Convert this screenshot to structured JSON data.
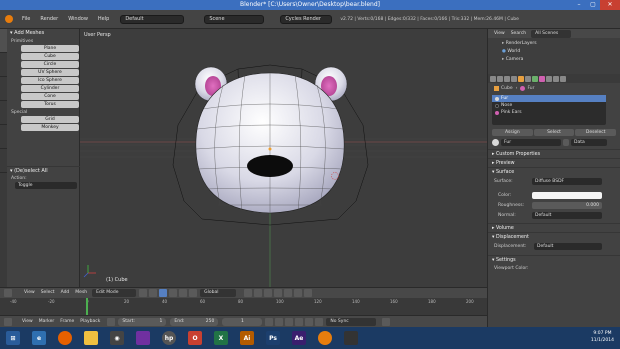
{
  "window": {
    "title": "Blender* [C:\\Users\\Owner\\Desktop\\bear.blend]",
    "minimize": "–",
    "maximize": "▢",
    "close": "✕"
  },
  "info_header": {
    "menus": [
      "File",
      "Render",
      "Window",
      "Help"
    ],
    "layout": "Default",
    "scene": "Scene",
    "engine": "Cycles Render",
    "stats": "v2.72 | Verts:0/168 | Edges:0/332 | Faces:0/166 | Tris:332 | Mem:26.46M | Cube"
  },
  "toolshelf": {
    "tabs": [
      "Tools",
      "Create",
      "Relations",
      "Animation",
      "Physics",
      "Grease Pencil"
    ],
    "add_meshes_header": "Add Meshes",
    "primitives_header": "Primitives",
    "primitives": [
      "Plane",
      "Cube",
      "Circle",
      "UV Sphere",
      "Ico Sphere",
      "Cylinder",
      "Cone",
      "Torus"
    ],
    "special_header": "Special",
    "special": [
      "Grid",
      "Monkey"
    ],
    "operator_header": "(De)select All",
    "action_label": "Action:",
    "action_value": "Toggle"
  },
  "viewport": {
    "view_label": "User Persp",
    "object_label": "(1) Cube"
  },
  "viewport_header": {
    "items": [
      "View",
      "Select",
      "Add",
      "Mesh"
    ],
    "mode": "Edit Mode",
    "pivot": "Global"
  },
  "timeline": {
    "ticks": [
      "-40",
      "-20",
      "0",
      "20",
      "40",
      "60",
      "80",
      "100",
      "120",
      "140",
      "160",
      "180",
      "200",
      "220",
      "240",
      "260"
    ],
    "current_frame": "1"
  },
  "timeline_header": {
    "items": [
      "View",
      "Marker",
      "Frame",
      "Playback"
    ],
    "start_label": "Start:",
    "start_value": "1",
    "end_label": "End:",
    "end_value": "250",
    "frame_value": "1",
    "sync": "No Sync"
  },
  "outliner": {
    "view_label": "View",
    "search_label": "Search",
    "scenes": "All Scenes",
    "rows": [
      "RenderLayers",
      "World",
      "Camera"
    ]
  },
  "properties": {
    "breadcrumb_object": "Cube",
    "breadcrumb_material": "Fur",
    "material_slots": [
      {
        "name": "Fur",
        "color": "#d8d8d8",
        "selected": true
      },
      {
        "name": "Nose",
        "color": "#111111",
        "selected": false
      },
      {
        "name": "Pink Ears",
        "color": "#d060b0",
        "selected": false
      }
    ],
    "assign_label": "Assign",
    "select_label": "Select",
    "deselect_label": "Deselect",
    "material_name": "Fur",
    "material_users": "Data",
    "sections": {
      "custom_properties": "Custom Properties",
      "preview": "Preview",
      "surface": "Surface",
      "volume": "Volume",
      "displacement": "Displacement",
      "settings": "Settings"
    },
    "surface_label": "Surface:",
    "surface_value": "Diffuse BSDF",
    "color_label": "Color:",
    "roughness_label": "Roughness:",
    "roughness_value": "0.000",
    "normal_label": "Normal:",
    "normal_value": "Default",
    "displacement_label": "Displacement:",
    "displacement_value": "Default",
    "viewport_color_label": "Viewport Color:"
  },
  "taskbar": {
    "time": "9:07 PM",
    "date": "11/1/2014"
  },
  "colors": {
    "viewport_bg": "#3d3d3d",
    "selection_blue": "#5680c2",
    "pink_ears": "#d060b0",
    "timeline_cursor": "#4caf50",
    "taskbar": "#1b3a63"
  }
}
